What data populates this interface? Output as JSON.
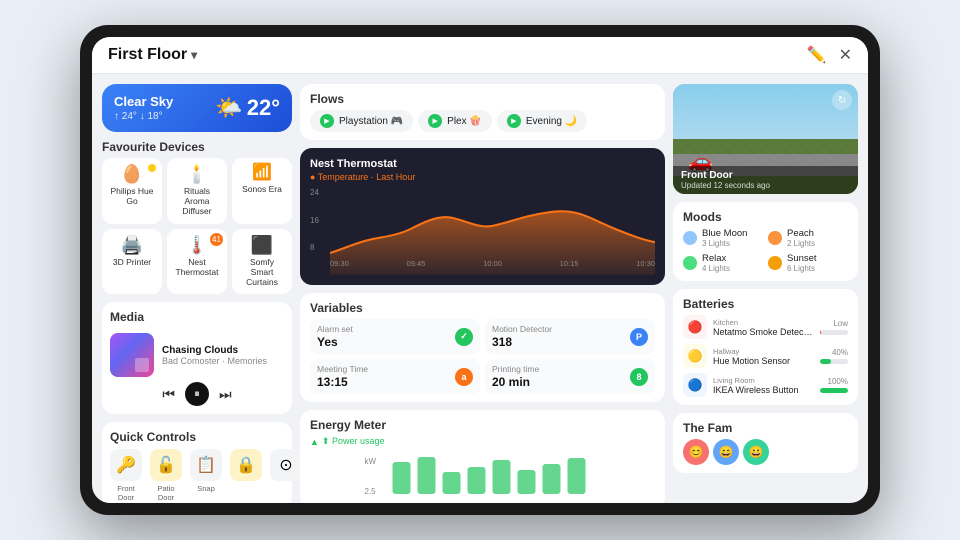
{
  "app": {
    "home_name": "First Floor",
    "edit_icon": "✏️",
    "close_icon": "✕"
  },
  "weather": {
    "condition": "Clear Sky",
    "high": "↑ 24°",
    "low": "↓ 18°",
    "icon": "🌤️",
    "temp": "22°"
  },
  "favourite_devices": {
    "title": "Favourite Devices",
    "items": [
      {
        "name": "Philips Hue Go",
        "icon": "🥚",
        "on": true
      },
      {
        "name": "Rituals Aroma Diffuser",
        "icon": "🕯️",
        "on": false
      },
      {
        "name": "Sonos Era",
        "icon": "📊",
        "on": false
      },
      {
        "name": "3D Printer",
        "icon": "📋",
        "on": false
      },
      {
        "name": "Nest Thermostat",
        "icon": "⊙",
        "badge": "41"
      },
      {
        "name": "Somfy Smart Curtains",
        "icon": "▬",
        "on": false
      }
    ]
  },
  "media": {
    "title": "Media",
    "track": "Chasing Clouds",
    "artist": "Bad Comoster · Memories"
  },
  "quick_controls": {
    "title": "Quick Controls",
    "items": [
      {
        "label": "Front Door",
        "icon": "🔑"
      },
      {
        "label": "Patio Door",
        "icon": "🔓"
      },
      {
        "label": "Snap",
        "icon": "📋"
      },
      {
        "label": "",
        "icon": "🔒"
      },
      {
        "label": "",
        "icon": "⭕"
      }
    ]
  },
  "flows": {
    "title": "Flows",
    "items": [
      {
        "label": "Playstation 🎮"
      },
      {
        "label": "Plex 🍿"
      },
      {
        "label": "Evening 🌙"
      }
    ]
  },
  "thermostat": {
    "title": "Nest Thermostat",
    "subtitle": "● Temperature · Last Hour",
    "y_labels": [
      "24",
      "16",
      "8"
    ],
    "x_labels": [
      "09:30",
      "09:45",
      "10:00",
      "10:15",
      "10:30"
    ]
  },
  "variables": {
    "title": "Variables",
    "items": [
      {
        "label": "Alarm set",
        "value": "Yes",
        "badge_color": "#22c55e",
        "badge_text": "✓"
      },
      {
        "label": "Motion Detector",
        "value": "318",
        "badge_color": "#3b82f6",
        "badge_text": "P"
      },
      {
        "label": "Meeting Time",
        "value": "13:15",
        "badge_color": "#f97316",
        "badge_text": "a"
      },
      {
        "label": "Printing time",
        "value": "20 min",
        "badge_color": "#22c55e",
        "badge_text": "8"
      }
    ]
  },
  "energy": {
    "title": "Energy Meter",
    "subtitle": "⬆ Power usage",
    "y_label": "kW",
    "y_values": [
      "2.5",
      ""
    ]
  },
  "camera": {
    "name": "Front Door",
    "updated": "Updated 12 seconds ago"
  },
  "moods": {
    "title": "Moods",
    "items": [
      {
        "name": "Blue Moon",
        "count": "3 Lights",
        "color": "#93c5fd"
      },
      {
        "name": "Peach",
        "count": "2 Lights",
        "color": "#fb923c"
      },
      {
        "name": "Relax",
        "count": "4 Lights",
        "color": "#4ade80"
      },
      {
        "name": "Sunset",
        "count": "6 Lights",
        "color": "#f59e0b"
      }
    ]
  },
  "batteries": {
    "title": "Batteries",
    "items": [
      {
        "location": "Kitchen",
        "name": "Netatmo Smoke Detector",
        "level": "Low",
        "pct": 5,
        "color": "#ef4444",
        "icon": "🔴",
        "bg": "#fef2f2"
      },
      {
        "location": "Hallway",
        "name": "Hue Motion Sensor",
        "level": "40%",
        "pct": 40,
        "color": "#22c55e",
        "icon": "🟡",
        "bg": "#fefce8"
      },
      {
        "location": "Living Room",
        "name": "IKEA Wireless Button",
        "level": "100%",
        "pct": 100,
        "color": "#22c55e",
        "icon": "🔵",
        "bg": "#eff6ff"
      }
    ]
  },
  "fam": {
    "title": "The Fam",
    "members": [
      "👤",
      "👤",
      "👤"
    ]
  }
}
